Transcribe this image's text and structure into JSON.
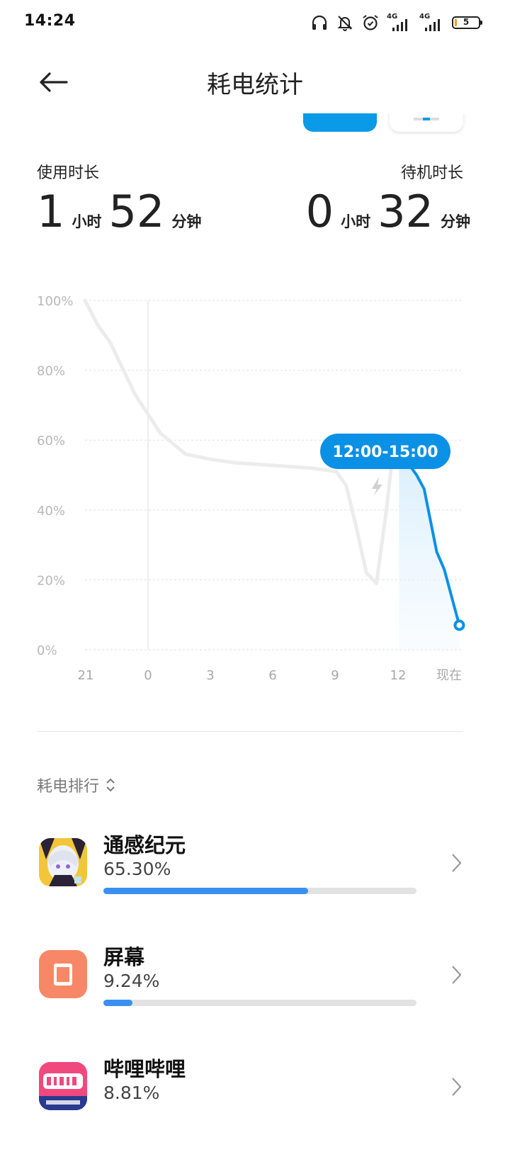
{
  "status": {
    "time": "14:24",
    "net1": "4G",
    "net2": "4G",
    "battery": "5",
    "icons": [
      "headphones-icon",
      "silent-bell-icon",
      "alarm-icon",
      "signal-icon",
      "signal-icon",
      "battery-icon"
    ]
  },
  "header": {
    "title": "耗电统计",
    "back_icon": "back-arrow-icon"
  },
  "usage": {
    "use_label": "使用时长",
    "use_hours": "1",
    "use_minutes": "52",
    "standby_label": "待机时长",
    "standby_hours": "0",
    "standby_minutes": "32",
    "hour_unit": "小时",
    "minute_unit": "分钟"
  },
  "chart_data": {
    "type": "line",
    "y_ticks": [
      "100%",
      "80%",
      "60%",
      "40%",
      "20%",
      "0%"
    ],
    "x_ticks": [
      "21",
      "0",
      "3",
      "6",
      "9",
      "12",
      "现在"
    ],
    "ylim": [
      0,
      100
    ],
    "tooltip": "12:00-15:00",
    "charging_icon": "lightning-icon",
    "history_series": {
      "x": [
        21,
        21.5,
        22,
        23,
        24,
        25,
        26,
        27,
        28,
        29,
        30,
        31,
        31.4,
        31.8,
        32.2,
        32.6,
        33,
        33.2,
        33.5
      ],
      "y": [
        100,
        93,
        88,
        73,
        62,
        56,
        54.5,
        53.5,
        53,
        52.5,
        52,
        51,
        47,
        35,
        22,
        19,
        40,
        53,
        53
      ]
    },
    "highlight_series": {
      "x": [
        33.5,
        34,
        34.2,
        34.5,
        35,
        35.3,
        35.9
      ],
      "y": [
        53,
        52,
        50,
        46,
        28,
        23,
        7
      ]
    },
    "highlight_start": 33.5,
    "highlight_end": 36,
    "grid": true,
    "legend": "none"
  },
  "ranking": {
    "title": "耗电排行",
    "sort_icon": "sort-updown-icon",
    "items": [
      {
        "name": "通感纪元",
        "percent": "65.30%",
        "fraction": 0.653,
        "icon": "anime-game-icon"
      },
      {
        "name": "屏幕",
        "percent": "9.24%",
        "fraction": 0.0924,
        "icon": "screen-icon"
      },
      {
        "name": "哔哩哔哩",
        "percent": "8.81%",
        "fraction": 0.0881,
        "icon": "bilibili-icon"
      }
    ]
  }
}
